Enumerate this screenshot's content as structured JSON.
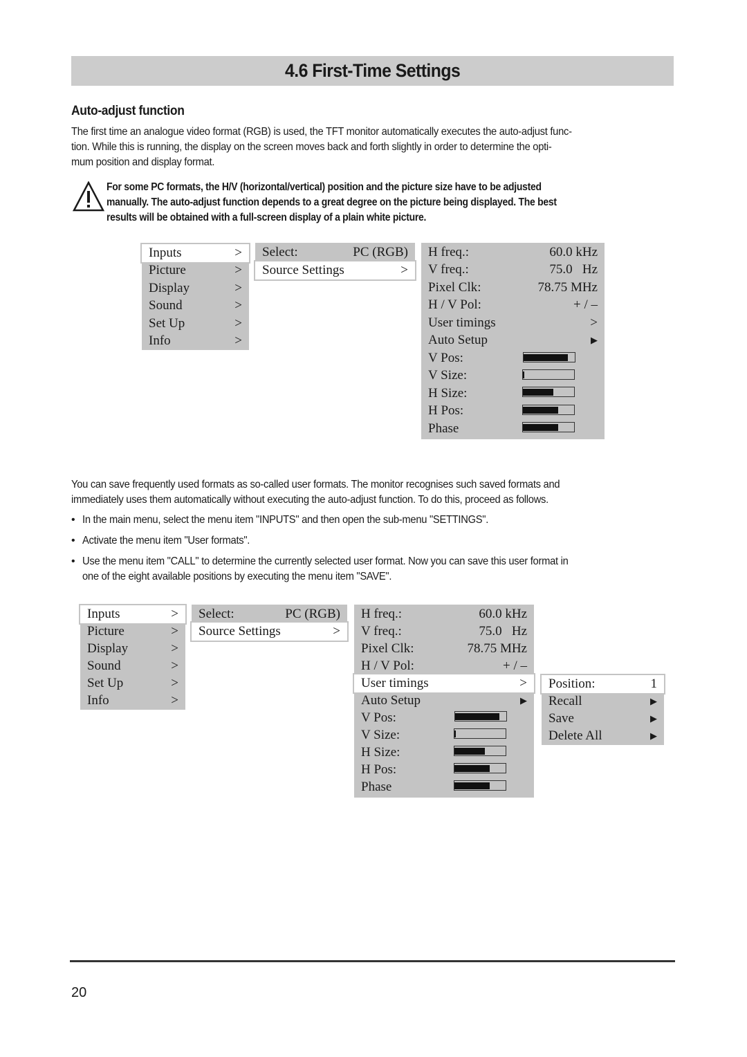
{
  "page": {
    "title": "4.6 First-Time Settings",
    "section_heading": "Auto-adjust function",
    "intro_lines": [
      "The first time an analogue video format (RGB) is used, the TFT monitor automatically executes the auto-adjust func-",
      "tion. While this is running, the display on the screen moves back and forth slightly in order to determine the opti-",
      "mum position and display format."
    ],
    "warning": {
      "icon": "warning-triangle-icon",
      "lines": [
        "For some PC formats, the H/V (horizontal/vertical) position and the picture size have to be adjusted",
        "manually. The auto-adjust function depends to a great degree on the picture being displayed. The best",
        "results will be obtained with a full-screen display of a plain white picture."
      ]
    },
    "user_formats_lines": [
      "You can save frequently used formats as so-called user formats. The monitor recognises such saved formats and",
      "immediately uses them automatically without executing the auto-adjust function. To do this, proceed as follows."
    ],
    "bullets": [
      {
        "lines": [
          "In the main menu, select the menu item \"INPUTS\" and then open the sub-menu \"SETTINGS\"."
        ]
      },
      {
        "lines": [
          "Activate the menu item \"User formats\"."
        ]
      },
      {
        "lines": [
          "Use the menu item \"CALL\" to determine the currently selected user format. Now you can save this user format in",
          "one of the eight available positions by executing the menu item \"SAVE\"."
        ]
      }
    ],
    "bullet_glyph": "•",
    "page_number": "20"
  },
  "osd": {
    "main_menu": [
      {
        "label": "Inputs",
        "arrow": ">",
        "selected": true
      },
      {
        "label": "Picture",
        "arrow": ">"
      },
      {
        "label": "Display",
        "arrow": ">"
      },
      {
        "label": "Sound",
        "arrow": ">"
      },
      {
        "label": "Set Up",
        "arrow": ">"
      },
      {
        "label": "Info",
        "arrow": ">"
      }
    ],
    "inputs_menu": [
      {
        "label": "Select:",
        "value": "PC (RGB)"
      },
      {
        "label": "Source Settings",
        "value": ">",
        "selected": true
      }
    ],
    "source_settings": [
      {
        "label": "H freq.:",
        "value": "60.0 kHz"
      },
      {
        "label": "V freq.:",
        "value": "75.0   Hz"
      },
      {
        "label": "Pixel Clk:",
        "value": "78.75 MHz"
      },
      {
        "label": "H / V Pol:",
        "value": "+ / –"
      },
      {
        "label": "User timings",
        "value": ">"
      },
      {
        "label": "Auto Setup",
        "value": "▶"
      }
    ],
    "sliders": [
      {
        "label": "V Pos:",
        "level": 0.86
      },
      {
        "label": "V Size:",
        "level": 0.03
      },
      {
        "label": "H Size:",
        "level": 0.6
      },
      {
        "label": "H Pos:",
        "level": 0.69
      },
      {
        "label": "Phase",
        "level": 0.69
      }
    ],
    "user_timings_menu": [
      {
        "label": "Position:",
        "value": "1",
        "selected": true
      },
      {
        "label": "Recall",
        "value": "▶"
      },
      {
        "label": "Save",
        "value": "▶"
      },
      {
        "label": "Delete All",
        "value": "▶"
      }
    ],
    "colors": {
      "panel": "#c4c4c4",
      "selected": "#ffffff",
      "title_bar": "#cccccc"
    }
  }
}
